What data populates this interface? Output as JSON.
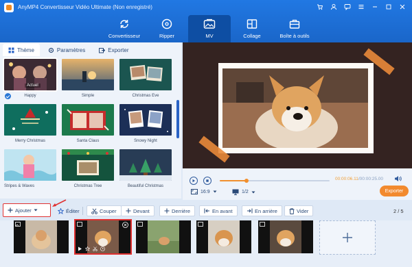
{
  "app": {
    "title": "AnyMP4 Convertisseur Vidéo Ultimate (Non enregistré)",
    "window_controls": [
      "cart-icon",
      "user-icon",
      "chat-icon",
      "menu-icon",
      "minimize-icon",
      "maximize-icon",
      "close-icon"
    ]
  },
  "nav": {
    "items": [
      {
        "label": "Convertisseur",
        "icon": "convert-icon",
        "active": false
      },
      {
        "label": "Ripper",
        "icon": "disc-icon",
        "active": false
      },
      {
        "label": "MV",
        "icon": "mv-icon",
        "active": true
      },
      {
        "label": "Collage",
        "icon": "collage-icon",
        "active": false
      },
      {
        "label": "Boîte à outils",
        "icon": "toolbox-icon",
        "active": false
      }
    ]
  },
  "left_tabs": {
    "items": [
      {
        "label": "Thème",
        "icon": "grid-icon",
        "active": true
      },
      {
        "label": "Paramètres",
        "icon": "gear-icon",
        "active": false
      },
      {
        "label": "Exporter",
        "icon": "export-icon",
        "active": false
      }
    ]
  },
  "themes": {
    "current_tag": "Actuel",
    "items": [
      {
        "label": "Happy",
        "selected": true
      },
      {
        "label": "Simple",
        "selected": false
      },
      {
        "label": "Christmas Eve",
        "selected": false
      },
      {
        "label": "Merry Christmas",
        "selected": false
      },
      {
        "label": "Santa Claus",
        "selected": false
      },
      {
        "label": "Snowy Night",
        "selected": false
      },
      {
        "label": "Stripes & Waves",
        "selected": false
      },
      {
        "label": "Christmas Tree",
        "selected": false
      },
      {
        "label": "Beautiful Christmas",
        "selected": false
      }
    ]
  },
  "player": {
    "current_time": "00:00:06.11",
    "total_time": "/00:00:25.00",
    "progress": 0.244,
    "aspect_ratio": "16:9",
    "page": "1/2",
    "export_label": "Exporter"
  },
  "toolbar": {
    "add": "Ajouter",
    "edit": "Éditer",
    "cut": "Couper",
    "forward": "Devant",
    "backward": "Derrière",
    "ahead": "En avant",
    "behind": "En arrière",
    "empty": "Vider",
    "count": "2 / 5"
  },
  "timeline": {
    "clips": [
      {
        "selected": false
      },
      {
        "selected": true
      },
      {
        "selected": false
      },
      {
        "selected": false
      },
      {
        "selected": false
      }
    ]
  },
  "colors": {
    "primary": "#1f6fd4",
    "accent": "#f28a2e",
    "highlight": "#e03030"
  }
}
